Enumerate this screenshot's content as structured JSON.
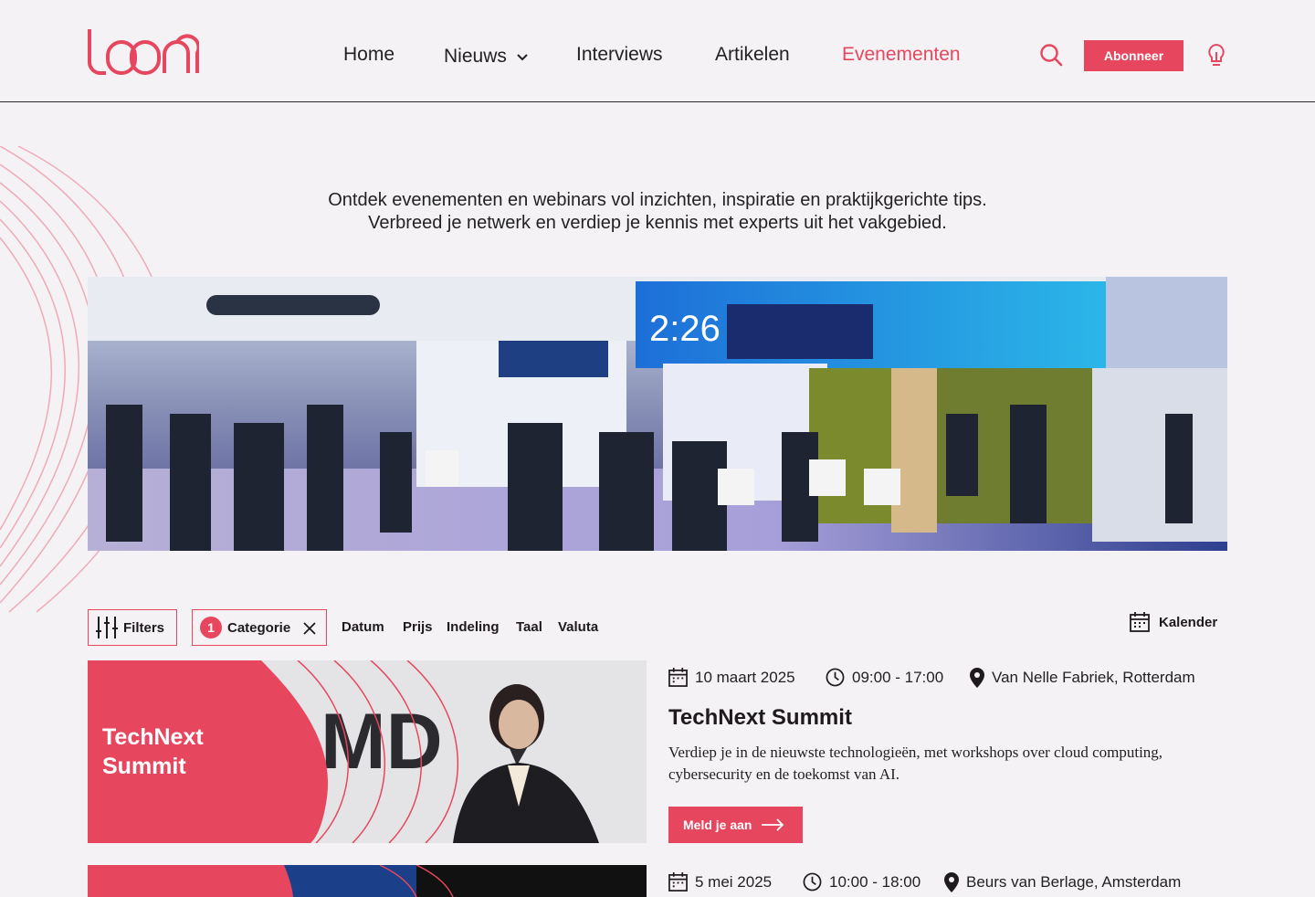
{
  "brand": {
    "logo_text": "loom",
    "accent": "#e6475f"
  },
  "nav": {
    "items": [
      {
        "label": "Home"
      },
      {
        "label": "Nieuws"
      },
      {
        "label": "Interviews"
      },
      {
        "label": "Artikelen"
      },
      {
        "label": "Evenementen"
      }
    ],
    "active": "Evenementen",
    "subscribe_label": "Abonneer",
    "icons": [
      "search-icon",
      "lightbulb-icon",
      "chevron-down-icon"
    ]
  },
  "intro": {
    "line1": "Ontdek evenementen en webinars vol inzichten, inspiratie en praktijkgerichte tips.",
    "line2": "Verbreed je netwerk en verdiep je kennis met experts uit het vakgebied."
  },
  "hero": {
    "alt": "Conference exhibition hall with booths and attendees"
  },
  "filters": {
    "filters_label": "Filters",
    "category_label": "Categorie",
    "category_count": "1",
    "options": [
      "Datum",
      "Prijs",
      "Indeling",
      "Taal",
      "Valuta"
    ],
    "calendar_label": "Kalender"
  },
  "events": [
    {
      "image_title_line1": "TechNext",
      "image_title_line2": "Summit",
      "date": "10 maart 2025",
      "time": "09:00 - 17:00",
      "location": "Van Nelle Fabriek, Rotterdam",
      "title": "TechNext Summit",
      "description_line1": "Verdiep je in de nieuwste technologieën, met workshops over cloud computing,",
      "description_line2": "cybersecurity en de toekomst van AI.",
      "cta_label": "Meld je aan"
    },
    {
      "date": "5 mei 2025",
      "time": "10:00 - 18:00",
      "location": "Beurs van Berlage, Amsterdam"
    }
  ]
}
